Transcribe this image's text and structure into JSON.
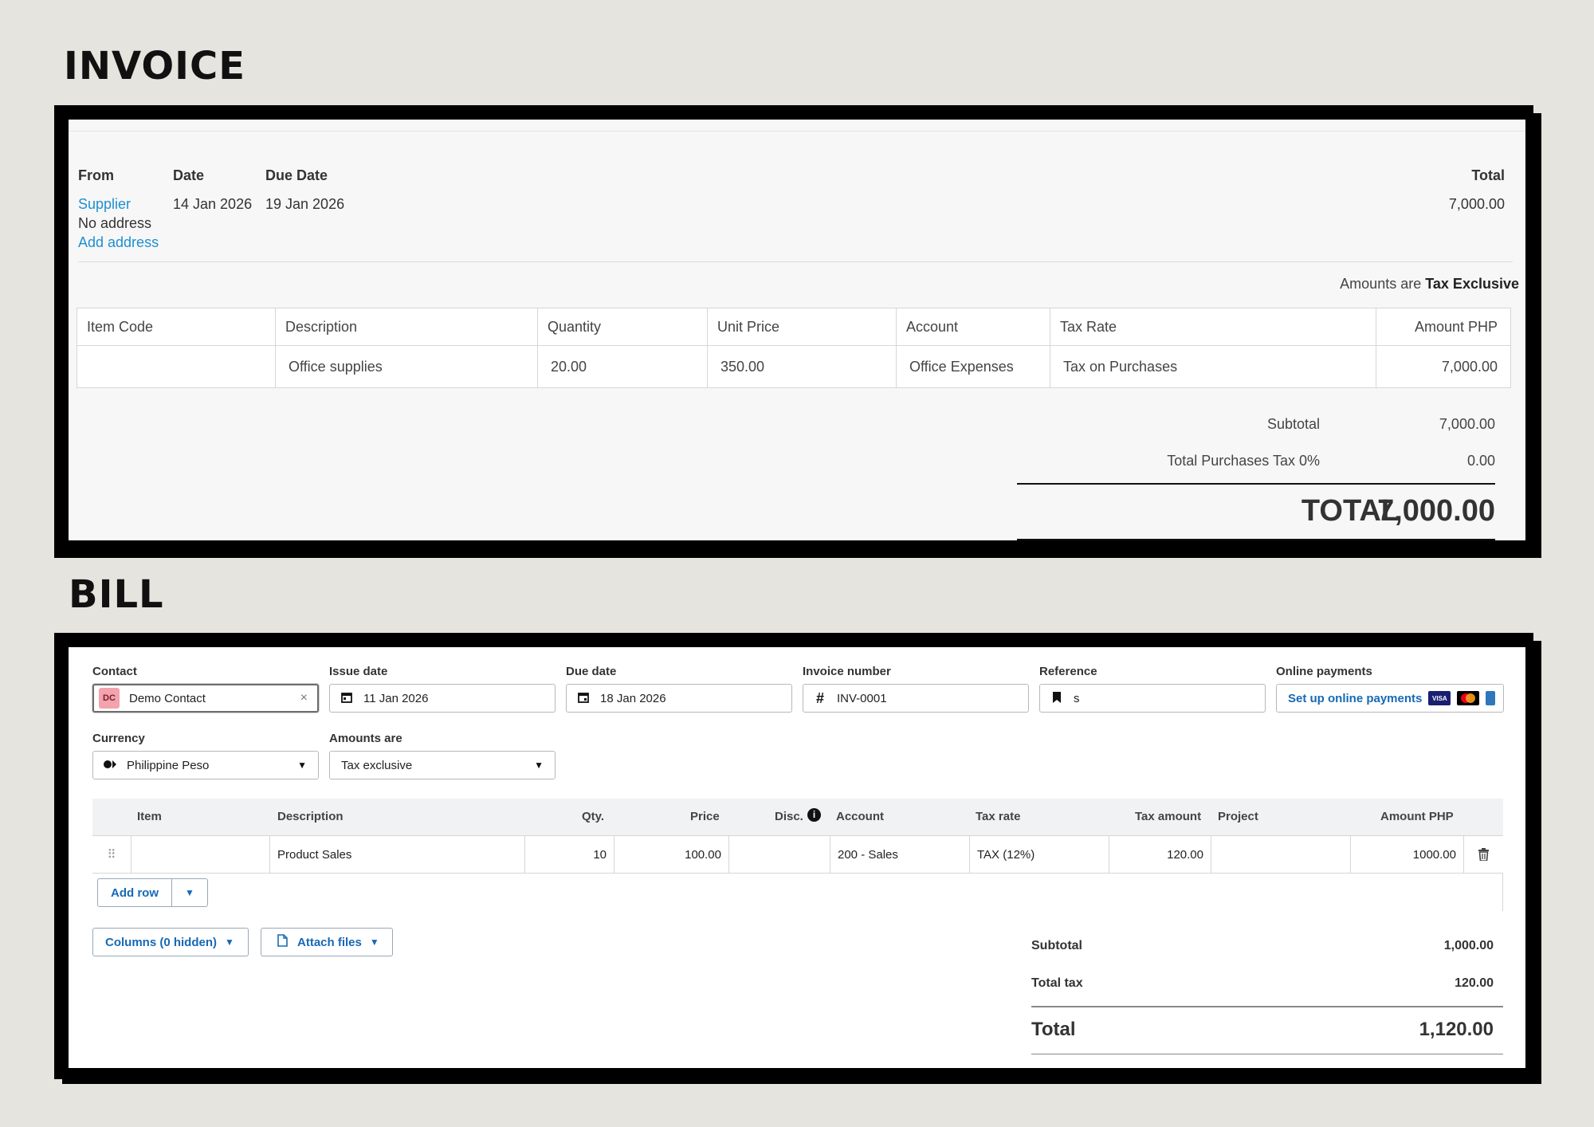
{
  "headings": {
    "invoice": "INVOICE",
    "bill": "BILL"
  },
  "invoice": {
    "labels": {
      "from": "From",
      "date": "Date",
      "due_date": "Due Date",
      "total": "Total"
    },
    "from_name": "Supplier",
    "from_address": "No address",
    "add_address": "Add address",
    "date": "14 Jan 2026",
    "due_date": "19 Jan 2026",
    "total": "7,000.00",
    "amounts_note_prefix": "Amounts are",
    "amounts_note_value": "Tax Exclusive",
    "columns": [
      "Item Code",
      "Description",
      "Quantity",
      "Unit Price",
      "Account",
      "Tax Rate",
      "Amount PHP"
    ],
    "row": {
      "item_code": "",
      "description": "Office supplies",
      "quantity": "20.00",
      "unit_price": "350.00",
      "account": "Office Expenses",
      "tax_rate": "Tax on Purchases",
      "amount": "7,000.00"
    },
    "subtotal_label": "Subtotal",
    "subtotal": "7,000.00",
    "tax_label": "Total Purchases Tax 0%",
    "tax": "0.00",
    "grand_total_label": "TOTAL",
    "grand_total": "7,000.00"
  },
  "bill": {
    "labels": {
      "contact": "Contact",
      "issue_date": "Issue date",
      "due_date": "Due date",
      "invoice_number": "Invoice number",
      "reference": "Reference",
      "online_payments": "Online payments",
      "currency": "Currency",
      "amounts_are": "Amounts are"
    },
    "contact_initials": "DC",
    "contact": "Demo Contact",
    "clear_symbol": "×",
    "issue_date": "11 Jan 2026",
    "due_date": "18 Jan 2026",
    "invoice_number": "INV-0001",
    "reference": "s",
    "online_payments_link": "Set up online payments",
    "card_visa": "VISA",
    "currency": "Philippine Peso",
    "amounts_are": "Tax exclusive",
    "columns": {
      "item": "Item",
      "description": "Description",
      "qty": "Qty.",
      "price": "Price",
      "disc": "Disc.",
      "account": "Account",
      "tax_rate": "Tax rate",
      "tax_amount": "Tax amount",
      "project": "Project",
      "amount": "Amount PHP"
    },
    "row": {
      "item": "",
      "description": "Product Sales",
      "qty": "10",
      "price": "100.00",
      "disc": "",
      "account": "200 - Sales",
      "tax_rate": "TAX (12%)",
      "tax_amount": "120.00",
      "project": "",
      "amount": "1000.00"
    },
    "add_row": "Add row",
    "columns_button": "Columns (0 hidden)",
    "attach_button": "Attach files",
    "subtotal_label": "Subtotal",
    "subtotal": "1,000.00",
    "tax_label": "Total tax",
    "tax": "120.00",
    "total_label": "Total",
    "total": "1,120.00"
  },
  "colors": {
    "link": "#1e8fcf",
    "bill_link": "#1769b5",
    "avatar_bg": "#f3a3ad",
    "background": "#e6e4df"
  }
}
